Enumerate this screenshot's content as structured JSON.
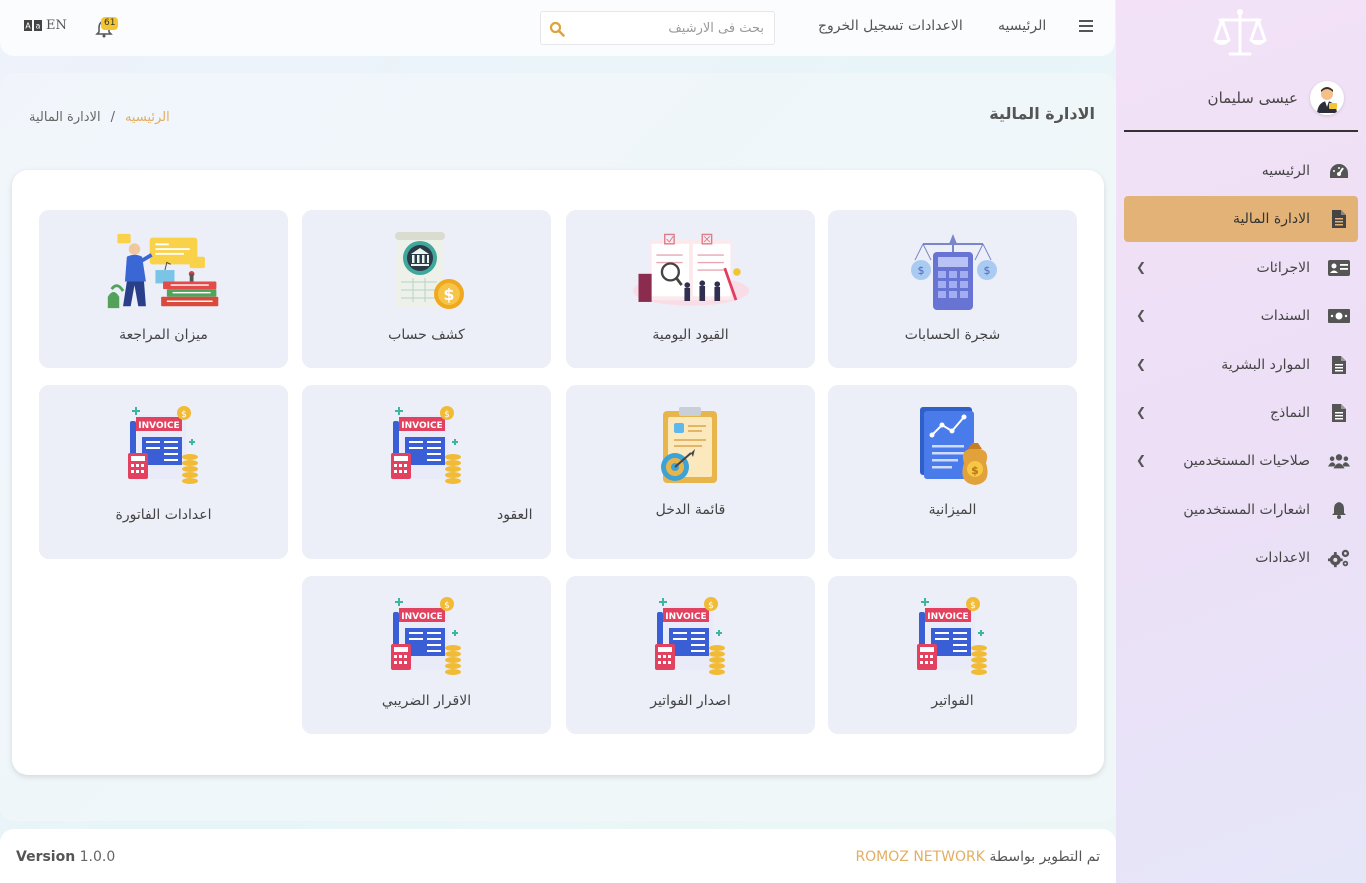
{
  "sidebar": {
    "user_name": "عيسى سليمان",
    "items": [
      {
        "label": "الرئيسيه",
        "icon": "dashboard-icon"
      },
      {
        "label": "الادارة المالية",
        "icon": "file-icon",
        "active": true
      },
      {
        "label": "الاجرائات",
        "icon": "id-card-icon"
      },
      {
        "label": "السندات",
        "icon": "money-icon"
      },
      {
        "label": "الموارد البشرية",
        "icon": "file-icon"
      },
      {
        "label": "النماذج",
        "icon": "file-icon"
      },
      {
        "label": "صلاحيات المستخدمين",
        "icon": "users-icon"
      },
      {
        "label": "اشعارات المستخدمين",
        "icon": "bell-icon"
      },
      {
        "label": "الاعدادات",
        "icon": "gears-icon"
      }
    ]
  },
  "topbar": {
    "lang": "EN",
    "notif_count": "61",
    "search_placeholder": "بحث فى الارشيف",
    "nav": {
      "home": "الرئيسيه",
      "settings": "الاعدادات",
      "logout": "تسجيل الخروج"
    }
  },
  "page": {
    "title": "الادارة المالية",
    "breadcrumb": {
      "home": "الرئيسيه",
      "sep": "/",
      "current": "الادارة المالية"
    }
  },
  "tiles": [
    {
      "label": "شجرة الحسابات",
      "icon": "calculator-balance-icon"
    },
    {
      "label": "القيود اليومية",
      "icon": "journal-review-icon"
    },
    {
      "label": "كشف حساب",
      "icon": "bank-statement-icon"
    },
    {
      "label": "ميزان المراجعة",
      "icon": "audit-presentation-icon"
    },
    {
      "label": "الميزانية",
      "icon": "budget-document-icon"
    },
    {
      "label": "قائمة الدخل",
      "icon": "income-clipboard-icon"
    },
    {
      "label": "العقود",
      "icon": "invoice-icon"
    },
    {
      "label": "اعدادات الفاتورة",
      "icon": "invoice-icon"
    },
    {
      "label": "الفواتير",
      "icon": "invoice-icon"
    },
    {
      "label": "اصدار الفواتير",
      "icon": "invoice-icon"
    },
    {
      "label": "الاقرار الضريبي",
      "icon": "invoice-icon"
    }
  ],
  "footer": {
    "version_label": "Version",
    "version_number": "1.0.0",
    "credit_prefix": "تم التطوير بواسطة",
    "credit_brand": "ROMOZ NETWORK"
  },
  "colors": {
    "accent": "#e3b277",
    "tile_bg": "#eceef8",
    "badge": "#f2c531"
  }
}
